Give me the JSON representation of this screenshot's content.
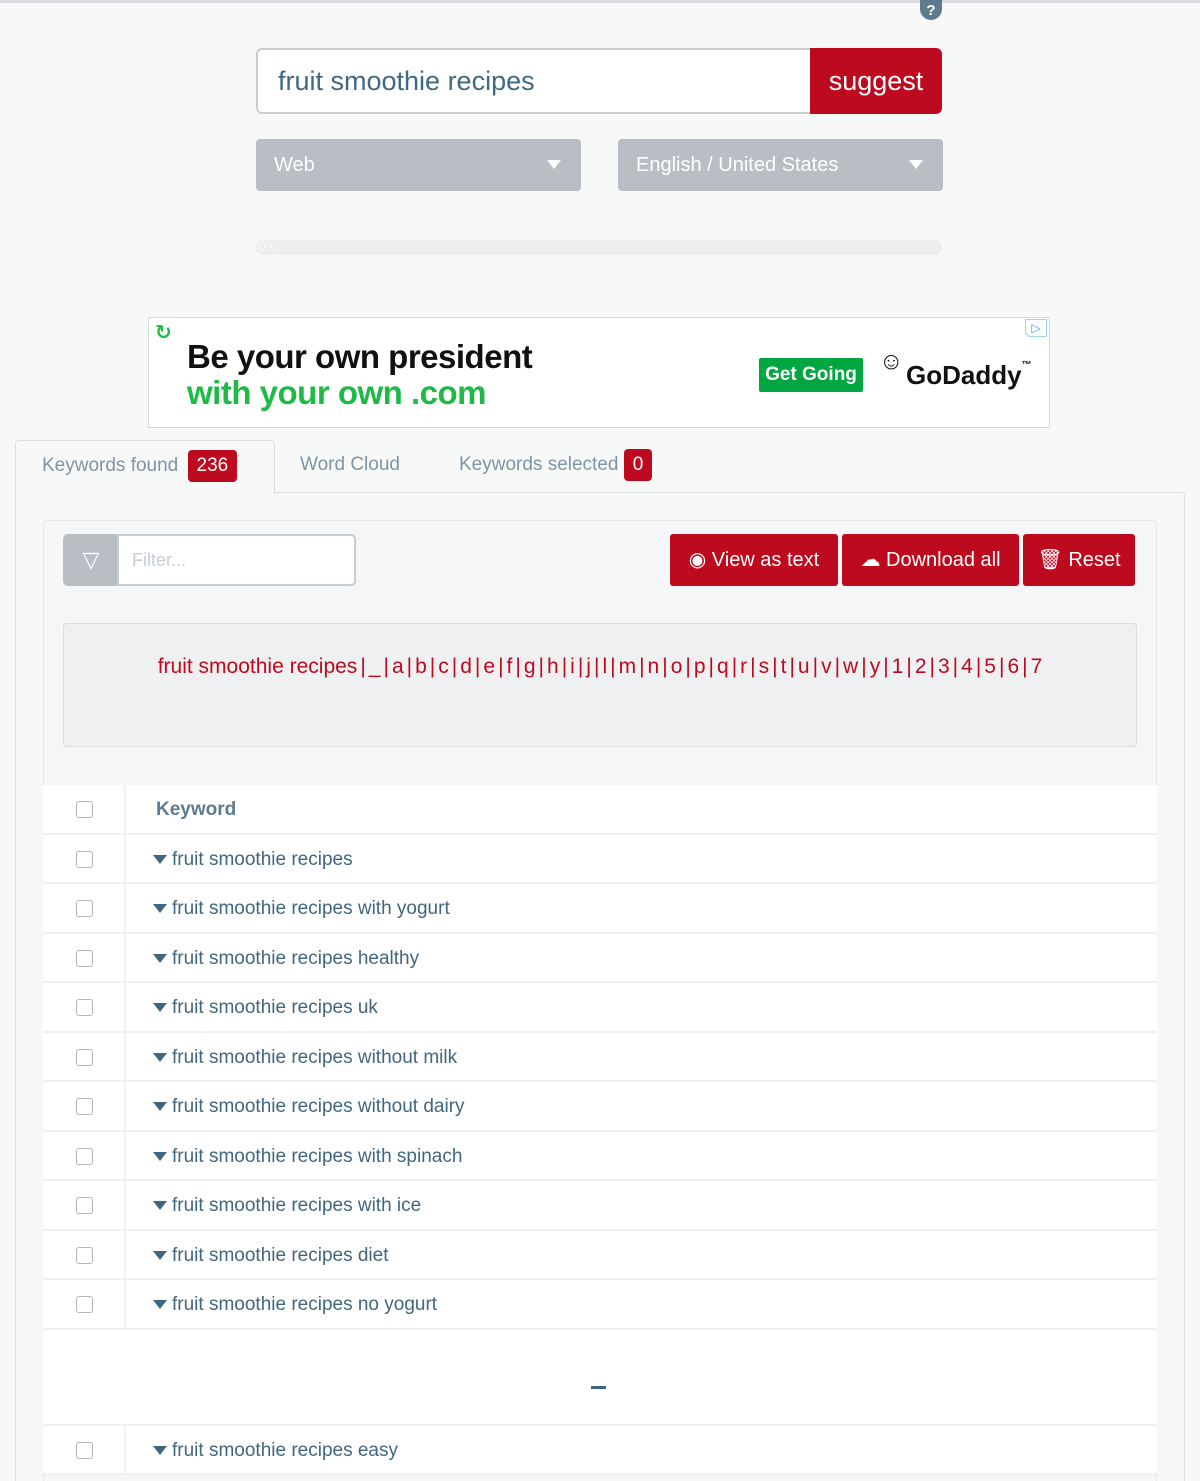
{
  "help": {
    "icon": "question-icon",
    "glyph": "?"
  },
  "search": {
    "value": "fruit smoothie recipes",
    "button": "suggest"
  },
  "selects": {
    "source": "Web",
    "language": "English / United States"
  },
  "progress": {
    "label": "0%",
    "value": 0
  },
  "ad": {
    "line1": "Be your own president",
    "line2": "with your own .com",
    "cta": "Get Going",
    "brand": "GoDaddy",
    "brand_mark": "™"
  },
  "tabs": {
    "found_label": "Keywords found",
    "found_count": "236",
    "cloud_label": "Word Cloud",
    "selected_label": "Keywords selected",
    "selected_count": "0"
  },
  "toolbar": {
    "filter_placeholder": "Filter...",
    "view_text": "View as text",
    "download": "Download all",
    "reset": "Reset"
  },
  "letters": [
    "fruit smoothie recipes",
    "_",
    "a",
    "b",
    "c",
    "d",
    "e",
    "f",
    "g",
    "h",
    "i",
    "j",
    "l",
    "m",
    "n",
    "o",
    "p",
    "q",
    "r",
    "s",
    "t",
    "u",
    "v",
    "w",
    "y",
    "1",
    "2",
    "3",
    "4",
    "5",
    "6",
    "7"
  ],
  "table": {
    "header": "Keyword",
    "rows": [
      "fruit smoothie recipes",
      "fruit smoothie recipes with yogurt",
      "fruit smoothie recipes healthy",
      "fruit smoothie recipes uk",
      "fruit smoothie recipes without milk",
      "fruit smoothie recipes without dairy",
      "fruit smoothie recipes with spinach",
      "fruit smoothie recipes with ice",
      "fruit smoothie recipes diet",
      "fruit smoothie recipes no yogurt"
    ],
    "after_gap": [
      "fruit smoothie recipes easy"
    ]
  },
  "colors": {
    "accent": "#be0a1e",
    "text": "#41667f",
    "muted": "#b8bec3",
    "ad_green": "#1dbb45"
  }
}
